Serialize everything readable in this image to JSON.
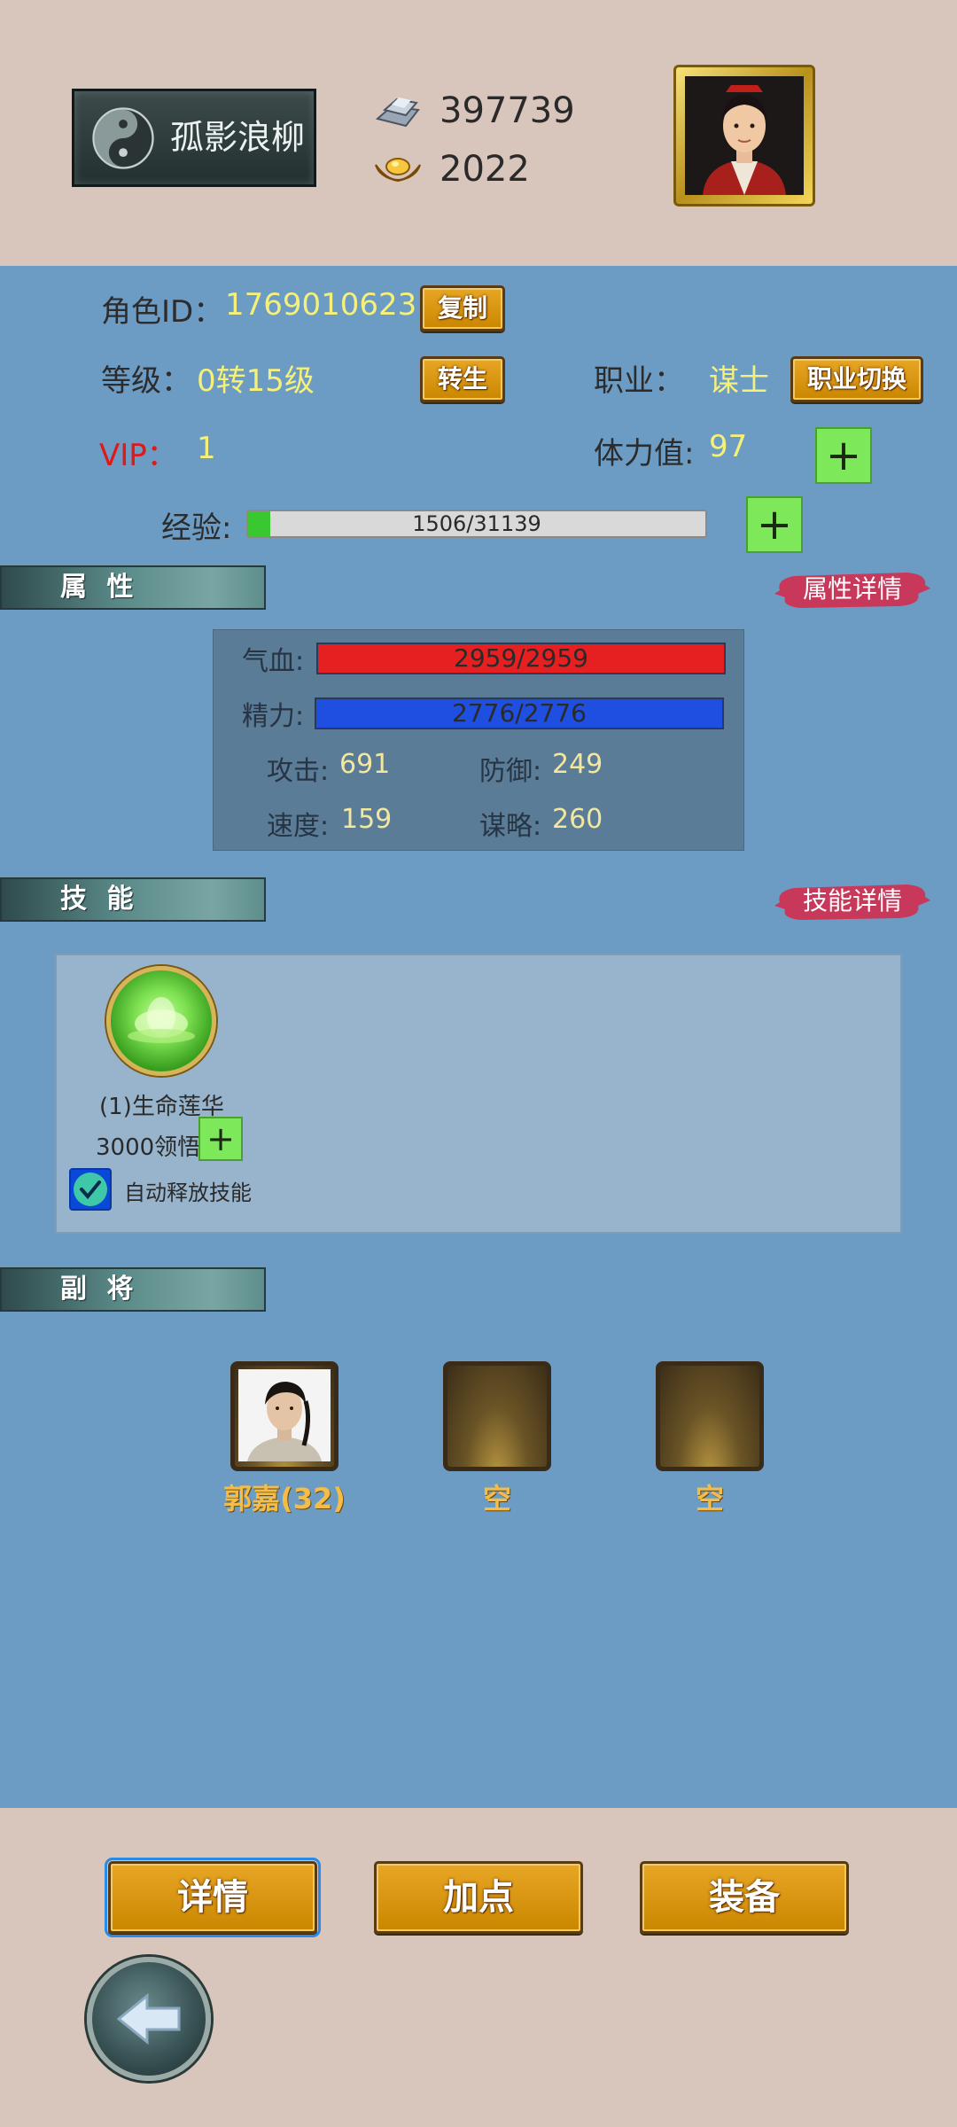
{
  "header": {
    "player_name": "孤影浪柳",
    "silver": "397739",
    "gold": "2022"
  },
  "profile": {
    "role_id_label": "角色ID：",
    "role_id_value": "1769010623",
    "copy_label": "复制",
    "level_label": "等级：",
    "level_value": "0转15级",
    "rebirth_label": "转生",
    "class_label": "职业：",
    "class_value": "谋士",
    "class_switch_label": "职业切换",
    "vip_label": "VIP：",
    "vip_value": "1",
    "stamina_label": "体力值:",
    "stamina_value": "97",
    "plus_symbol": "+",
    "exp_label": "经验:",
    "exp_text": "1506/31139",
    "exp_current": 1506,
    "exp_max": 31139
  },
  "attributes": {
    "title": "属 性",
    "details_label": "属性详情",
    "hp_label": "气血:",
    "hp_text": "2959/2959",
    "hp_fraction": 1.0,
    "mp_label": "精力:",
    "mp_text": "2776/2776",
    "mp_fraction": 1.0,
    "attack_label": "攻击:",
    "attack_value": "691",
    "defense_label": "防御:",
    "defense_value": "249",
    "speed_label": "速度:",
    "speed_value": "159",
    "strategy_label": "谋略:",
    "strategy_value": "260"
  },
  "skills": {
    "title": "技 能",
    "details_label": "技能详情",
    "skill_name": "(1)生命莲华",
    "skill_cost": "3000领悟",
    "auto_release_label": "自动释放技能",
    "auto_release_checked": true
  },
  "generals": {
    "title": "副 将",
    "slots": [
      {
        "name": "郭嘉(32)"
      },
      {
        "name": "空"
      },
      {
        "name": "空"
      }
    ]
  },
  "tabs": {
    "details": "详情",
    "add_points": "加点",
    "equipment": "装备"
  },
  "colors": {
    "main_bg": "#6c9cc4",
    "frame_bg": "#d8c6bc",
    "hp_bar": "#e62020",
    "mp_bar": "#1f4fe0",
    "exp_bar": "#3ac830",
    "button_gold": "#d89a10",
    "plus_green": "#7de85a"
  },
  "icons": {
    "yinyang": "yinyang-icon",
    "silver": "silver-ingot-icon",
    "gold": "gold-ingot-icon",
    "back": "back-arrow-icon",
    "checkmark": "checkmark-icon"
  }
}
